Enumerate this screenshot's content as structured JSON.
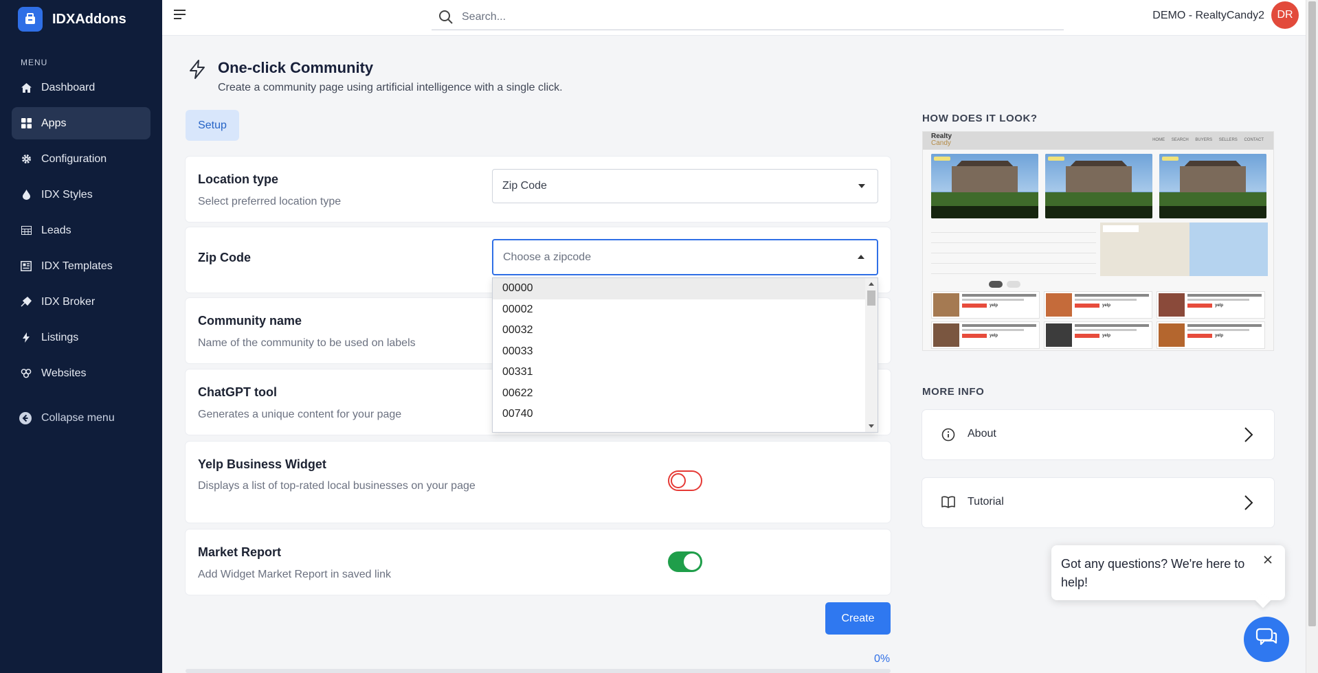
{
  "brand": {
    "name": "IDXAddons"
  },
  "sidebar": {
    "menu_label": "MENU",
    "items": [
      {
        "label": "Dashboard",
        "icon": "home-icon"
      },
      {
        "label": "Apps",
        "icon": "apps-grid-icon",
        "active": true
      },
      {
        "label": "Configuration",
        "icon": "gear-icon"
      },
      {
        "label": "IDX Styles",
        "icon": "droplet-icon"
      },
      {
        "label": "Leads",
        "icon": "table-icon"
      },
      {
        "label": "IDX Templates",
        "icon": "template-icon"
      },
      {
        "label": "IDX Broker",
        "icon": "broker-icon"
      },
      {
        "label": "Listings",
        "icon": "bolt-icon"
      },
      {
        "label": "Websites",
        "icon": "websites-icon"
      }
    ],
    "collapse_label": "Collapse menu"
  },
  "topbar": {
    "search_placeholder": "Search...",
    "user_name": "DEMO - RealtyCandy2",
    "avatar_initials": "DR"
  },
  "page": {
    "title": "One-click Community",
    "subtitle": "Create a community page using artificial intelligence with a single click.",
    "tab_setup": "Setup"
  },
  "form": {
    "location_type": {
      "title": "Location type",
      "desc": "Select preferred location type",
      "value": "Zip Code"
    },
    "zip_code": {
      "title": "Zip Code",
      "placeholder": "Choose a zipcode",
      "options": [
        "00000",
        "00002",
        "00032",
        "00033",
        "00331",
        "00622",
        "00740"
      ]
    },
    "community_name": {
      "title": "Community name",
      "desc": "Name of the community to be used on labels"
    },
    "chatgpt": {
      "title": "ChatGPT tool",
      "desc": "Generates a unique content for your page"
    },
    "yelp": {
      "title": "Yelp Business Widget",
      "desc": "Displays a list of top-rated local businesses on your page",
      "enabled": false
    },
    "market_report": {
      "title": "Market Report",
      "desc": "Add Widget Market Report in saved link",
      "enabled": true
    },
    "create_label": "Create",
    "progress_label": "0%",
    "progress": 0
  },
  "preview": {
    "heading": "HOW DOES IT LOOK?",
    "logo_top": "Realty",
    "logo_bottom": "Candy",
    "nav": "HOME SEARCH BUYERS SELLERS CONTACT",
    "yelp_label": "yelp"
  },
  "more_info": {
    "heading": "MORE INFO",
    "about": "About",
    "tutorial": "Tutorial"
  },
  "chat": {
    "message": "Got any questions? We're here to help!"
  },
  "colors": {
    "sidebar_bg": "#0f1d3a",
    "accent": "#2f78f0",
    "toggle_off": "#e53935",
    "toggle_on": "#1f9e4a",
    "avatar": "#e24a3b"
  }
}
